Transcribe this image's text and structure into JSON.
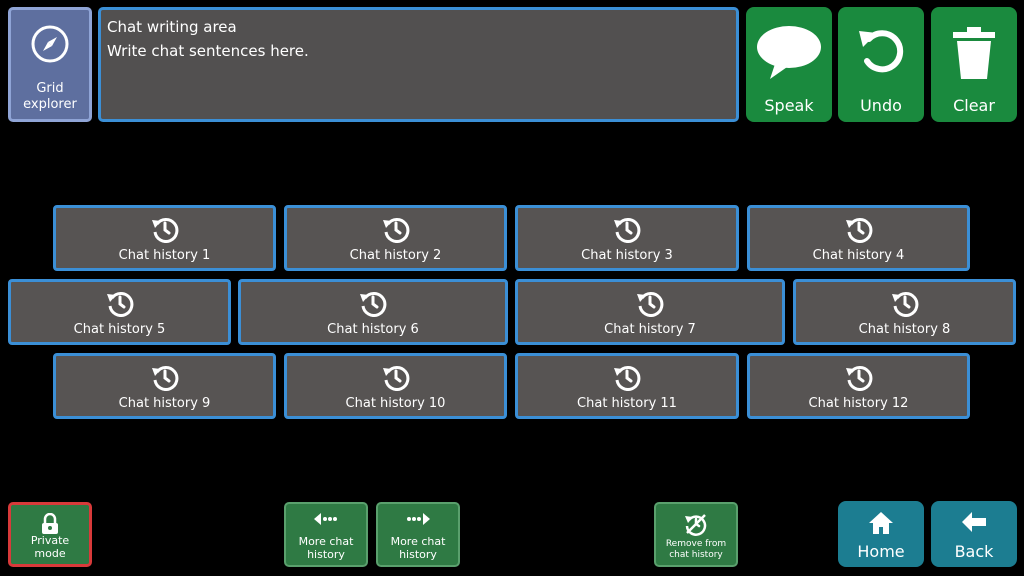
{
  "top": {
    "grid_explorer": {
      "label_line1": "Grid",
      "label_line2": "explorer",
      "icon": "compass-icon"
    },
    "chat_area": {
      "title": "Chat writing area",
      "text": "Write chat sentences here."
    },
    "speak": {
      "label": "Speak",
      "icon": "speech-bubble-icon"
    },
    "undo": {
      "label": "Undo",
      "icon": "undo-icon"
    },
    "clear": {
      "label": "Clear",
      "icon": "trash-icon"
    }
  },
  "history": {
    "icon": "history-icon",
    "items": [
      "Chat history 1",
      "Chat history 2",
      "Chat history 3",
      "Chat history 4",
      "Chat history 5",
      "Chat history 6",
      "Chat history 7",
      "Chat history 8",
      "Chat history 9",
      "Chat history 10",
      "Chat history 11",
      "Chat history 12"
    ]
  },
  "bottom": {
    "private_mode": {
      "line1": "Private",
      "line2": "mode",
      "icon": "lock-icon"
    },
    "more_prev": {
      "line1": "More chat",
      "line2": "history",
      "icon": "arrow-left-dots-icon"
    },
    "more_next": {
      "line1": "More chat",
      "line2": "history",
      "icon": "arrow-right-dots-icon"
    },
    "remove": {
      "line1": "Remove from",
      "line2": "chat history",
      "icon": "history-remove-icon"
    },
    "home": {
      "label": "Home",
      "icon": "home-icon"
    },
    "back": {
      "label": "Back",
      "icon": "back-arrow-icon"
    }
  },
  "colors": {
    "accent_blue": "#3b8fd6",
    "action_green": "#1a8a3e",
    "nav_teal": "#1c7d91",
    "tile_gray": "#575453",
    "private_border": "#d83a3a"
  }
}
